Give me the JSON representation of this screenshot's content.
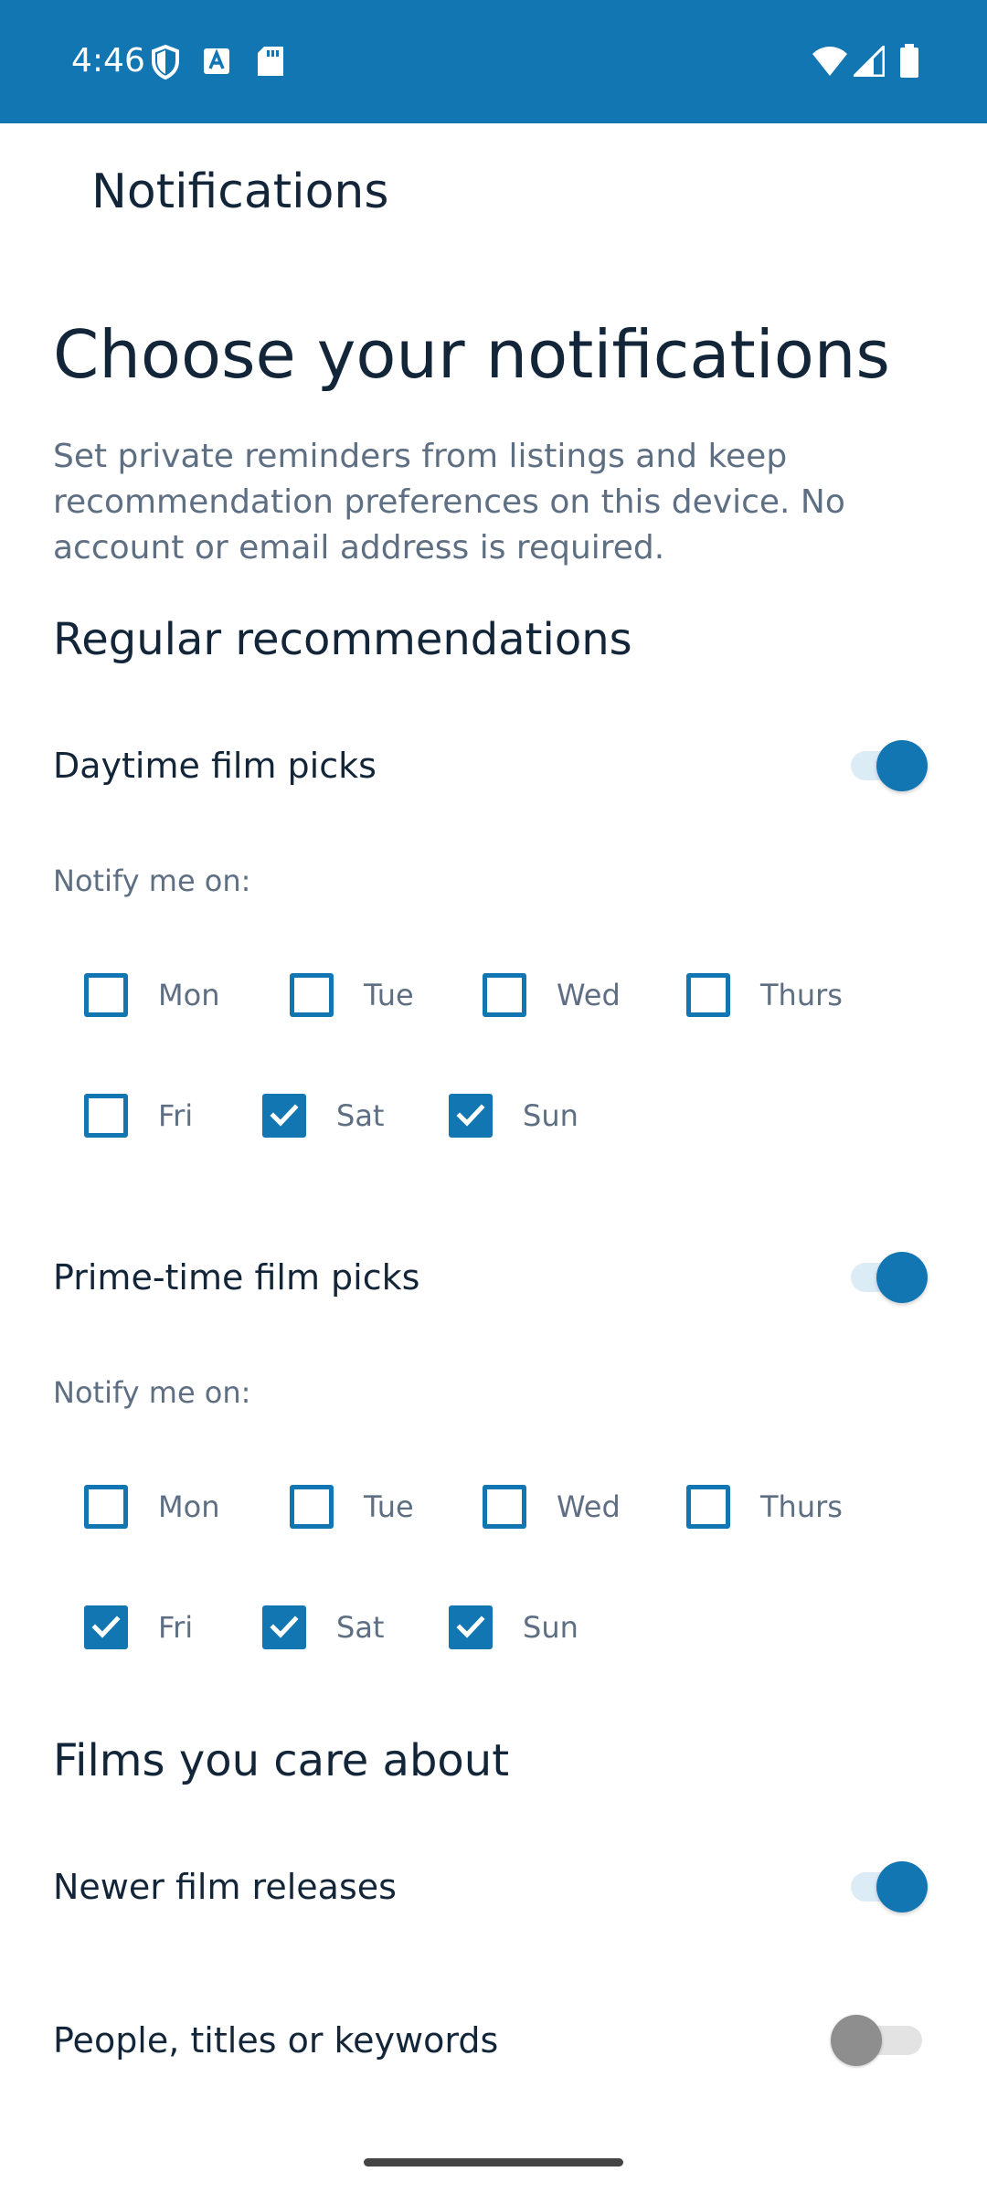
{
  "status_bar": {
    "time": "4:46",
    "icons_left": [
      "shield-icon",
      "a-badge-icon",
      "sd-card-icon"
    ],
    "icons_right": [
      "wifi-icon",
      "signal-icon",
      "battery-icon"
    ],
    "color": "#1276b3"
  },
  "app_bar": {
    "title": "Notifications"
  },
  "headline": "Choose your notifications",
  "intro": "Set private reminders from listings and keep recommendation preferences on this device. No account or email address is required.",
  "regular": {
    "title": "Regular recommendations",
    "daytime": {
      "label": "Daytime film picks",
      "enabled": true,
      "notify_label": "Notify me on:",
      "days": [
        {
          "label": "Mon",
          "checked": false
        },
        {
          "label": "Tue",
          "checked": false
        },
        {
          "label": "Wed",
          "checked": false
        },
        {
          "label": "Thurs",
          "checked": false
        },
        {
          "label": "Fri",
          "checked": false
        },
        {
          "label": "Sat",
          "checked": true
        },
        {
          "label": "Sun",
          "checked": true
        }
      ]
    },
    "primetime": {
      "label": "Prime-time film picks",
      "enabled": true,
      "notify_label": "Notify me on:",
      "days": [
        {
          "label": "Mon",
          "checked": false
        },
        {
          "label": "Tue",
          "checked": false
        },
        {
          "label": "Wed",
          "checked": false
        },
        {
          "label": "Thurs",
          "checked": false
        },
        {
          "label": "Fri",
          "checked": true
        },
        {
          "label": "Sat",
          "checked": true
        },
        {
          "label": "Sun",
          "checked": true
        }
      ]
    }
  },
  "care": {
    "title": "Films you care about",
    "newer": {
      "label": "Newer film releases",
      "enabled": true
    },
    "people": {
      "label": "People, titles or keywords",
      "enabled": false
    }
  },
  "colors": {
    "accent": "#1276b3",
    "text_dark": "#132538",
    "text_muted": "#5e6f83"
  }
}
